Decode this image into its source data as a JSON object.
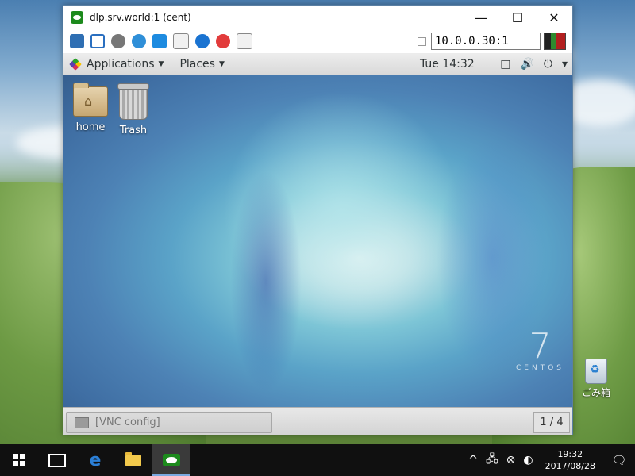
{
  "window": {
    "title": "dlp.srv.world:1 (cent)",
    "controls": {
      "minimize": "—",
      "maximize": "☐",
      "close": "✕"
    },
    "address": "10.0.0.30:1"
  },
  "gnome_panel": {
    "applications": "Applications",
    "places": "Places",
    "clock": "Tue 14:32",
    "caret": "▼",
    "status_icons": [
      "□",
      "🔊",
      "⏻",
      "▾"
    ]
  },
  "remote_desktop": {
    "icons": [
      {
        "label": "home"
      },
      {
        "label": "Trash"
      }
    ],
    "os_number": "7",
    "os_name": "CENTOS"
  },
  "gnome_bottom": {
    "task_label": "[VNC config]",
    "pager": "1 / 4"
  },
  "desktop": {
    "recycle_bin_label": "ごみ箱"
  },
  "taskbar": {
    "time": "19:32",
    "date": "2017/08/28",
    "tray_icons": [
      "^",
      "🖧",
      "⊗",
      "◐"
    ],
    "notification_icon": "🗨"
  }
}
